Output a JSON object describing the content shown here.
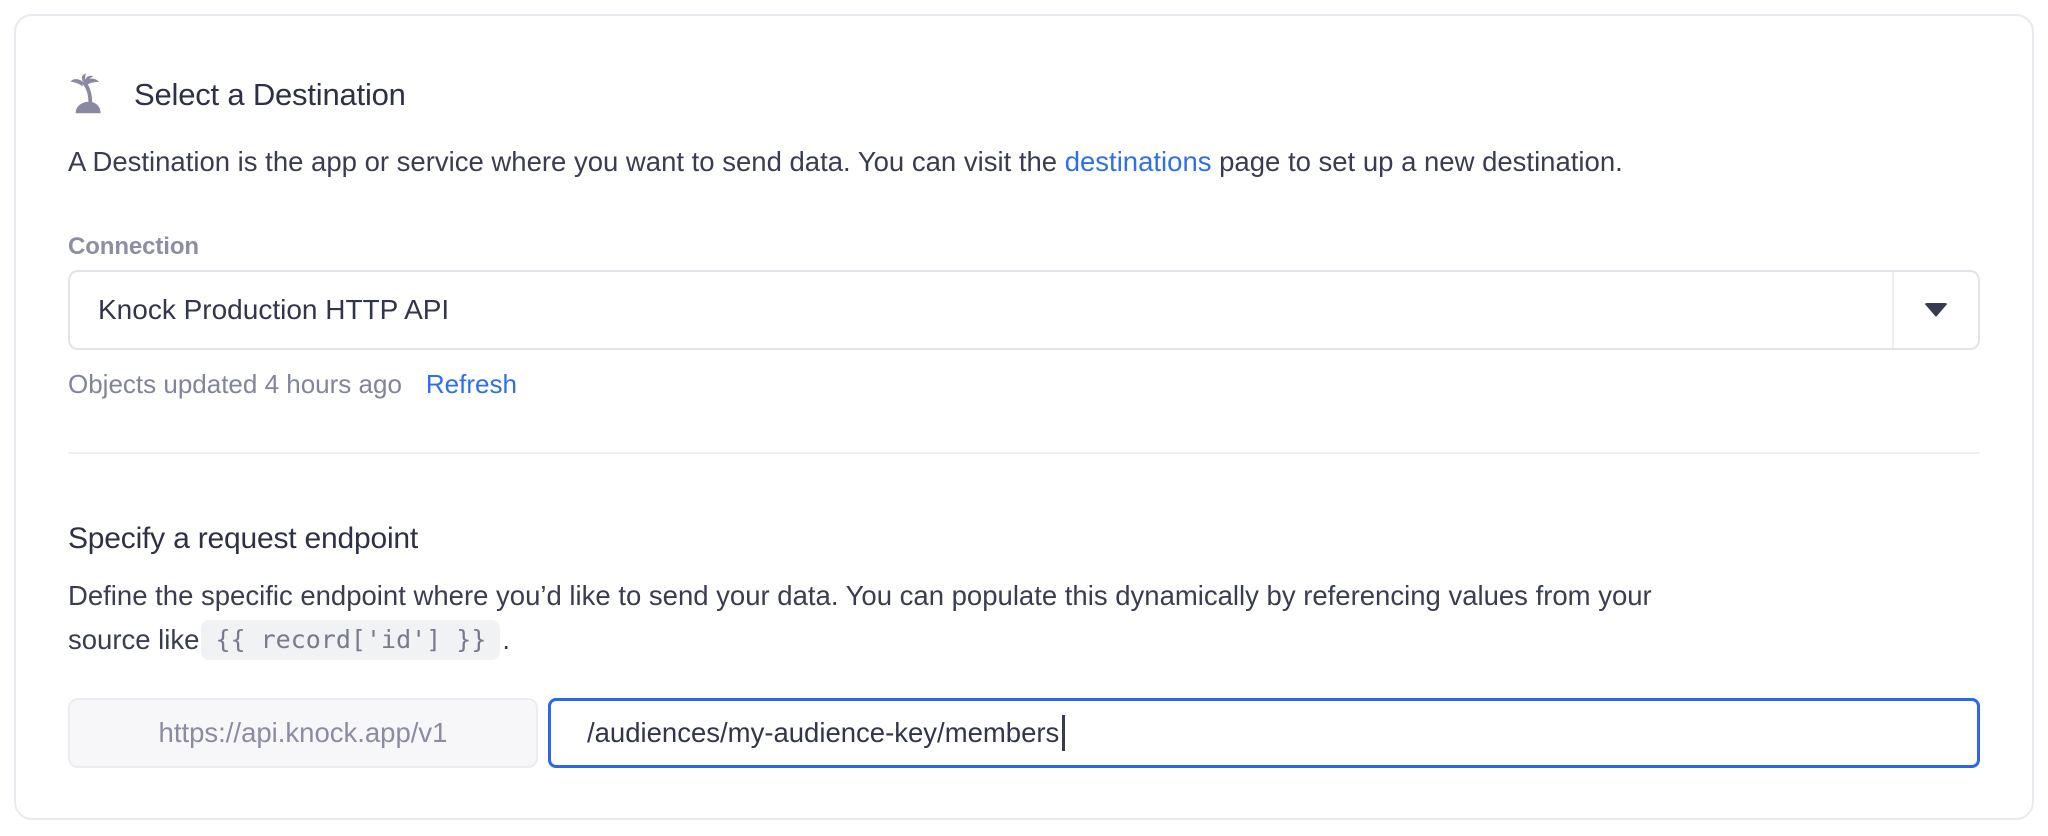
{
  "card": {
    "header": {
      "icon": "palm-tree-icon",
      "title": "Select a Destination"
    },
    "intro": {
      "text_before_link": "A Destination is the app or service where you want to send data. You can visit the ",
      "link_label": "destinations",
      "text_after_link": " page to set up a new destination."
    },
    "connection": {
      "label": "Connection",
      "selected_option": "Knock Production HTTP API",
      "status_text": "Objects updated 4 hours ago",
      "refresh_label": "Refresh"
    },
    "endpoint": {
      "title": "Specify a request endpoint",
      "description_line1": "Define the specific endpoint where you’d like to send your data. You can populate this dynamically by referencing values from your",
      "description_line2_prefix": "source like ",
      "code_sample": "{{ record['id'] }}",
      "description_suffix": " .",
      "base_url": "https://api.knock.app/v1",
      "path_value": "/audiences/my-audience-key/members"
    }
  },
  "colors": {
    "link_blue": "#2F6FEB",
    "focus_border_blue": "#2D66EE",
    "heading_text": "#2E3145",
    "body_text": "#3A3D52",
    "muted_text": "#82849B",
    "icon_gray_purple": "#8A89A3",
    "card_border": "#E9EAEF"
  }
}
